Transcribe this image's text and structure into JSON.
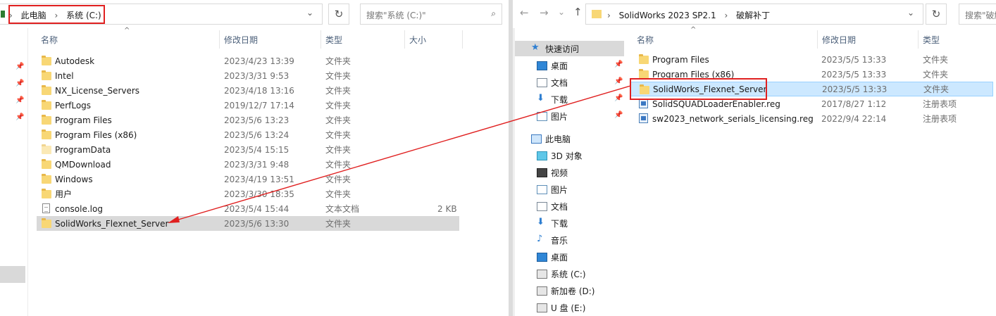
{
  "left": {
    "breadcrumb": [
      "此电脑",
      "系统 (C:)"
    ],
    "search_placeholder": "搜索\"系统 (C:)\"",
    "columns": {
      "name": "名称",
      "date": "修改日期",
      "type": "类型",
      "size": "大小"
    },
    "files": [
      {
        "name": "Autodesk",
        "date": "2023/4/23 13:39",
        "type": "文件夹",
        "size": "",
        "icon": "folder-icon"
      },
      {
        "name": "Intel",
        "date": "2023/3/31 9:53",
        "type": "文件夹",
        "size": "",
        "icon": "folder-icon"
      },
      {
        "name": "NX_License_Servers",
        "date": "2023/4/18 13:16",
        "type": "文件夹",
        "size": "",
        "icon": "folder-icon"
      },
      {
        "name": "PerfLogs",
        "date": "2019/12/7 17:14",
        "type": "文件夹",
        "size": "",
        "icon": "folder-icon"
      },
      {
        "name": "Program Files",
        "date": "2023/5/6 13:23",
        "type": "文件夹",
        "size": "",
        "icon": "folder-icon"
      },
      {
        "name": "Program Files (x86)",
        "date": "2023/5/6 13:24",
        "type": "文件夹",
        "size": "",
        "icon": "folder-icon"
      },
      {
        "name": "ProgramData",
        "date": "2023/5/4 15:15",
        "type": "文件夹",
        "size": "",
        "icon": "folder-pale-icon"
      },
      {
        "name": "QMDownload",
        "date": "2023/3/31 9:48",
        "type": "文件夹",
        "size": "",
        "icon": "folder-icon"
      },
      {
        "name": "Windows",
        "date": "2023/4/19 13:51",
        "type": "文件夹",
        "size": "",
        "icon": "folder-icon"
      },
      {
        "name": "用户",
        "date": "2023/3/30 18:35",
        "type": "文件夹",
        "size": "",
        "icon": "folder-icon"
      },
      {
        "name": "console.log",
        "date": "2023/5/4 15:44",
        "type": "文本文档",
        "size": "2 KB",
        "icon": "text-file-icon"
      },
      {
        "name": "SolidWorks_Flexnet_Server",
        "date": "2023/5/6 13:30",
        "type": "文件夹",
        "size": "",
        "icon": "folder-icon"
      }
    ]
  },
  "right": {
    "breadcrumb": [
      "SolidWorks 2023 SP2.1",
      "破解补丁"
    ],
    "search_placeholder": "搜索\"破解",
    "columns": {
      "name": "名称",
      "date": "修改日期",
      "type": "类型"
    },
    "nav": [
      {
        "label": "快速访问",
        "icon": "star-icon",
        "pinned": false
      },
      {
        "label": "桌面",
        "icon": "desktop-icon",
        "pinned": true
      },
      {
        "label": "文档",
        "icon": "documents-icon",
        "pinned": true
      },
      {
        "label": "下载",
        "icon": "download-icon",
        "pinned": true
      },
      {
        "label": "图片",
        "icon": "pictures-icon",
        "pinned": true
      },
      {
        "label": "此电脑",
        "icon": "computer-icon",
        "pinned": false
      },
      {
        "label": "3D 对象",
        "icon": "3d-objects-icon",
        "pinned": false
      },
      {
        "label": "视频",
        "icon": "video-icon",
        "pinned": false
      },
      {
        "label": "图片",
        "icon": "pictures-icon",
        "pinned": false
      },
      {
        "label": "文档",
        "icon": "documents-icon",
        "pinned": false
      },
      {
        "label": "下载",
        "icon": "download-icon",
        "pinned": false
      },
      {
        "label": "音乐",
        "icon": "music-icon",
        "pinned": false
      },
      {
        "label": "桌面",
        "icon": "desktop-icon",
        "pinned": false
      },
      {
        "label": "系统 (C:)",
        "icon": "drive-icon",
        "pinned": false
      },
      {
        "label": "新加卷 (D:)",
        "icon": "drive-icon",
        "pinned": false
      },
      {
        "label": "U 盘 (E:)",
        "icon": "usb-drive-icon",
        "pinned": false
      }
    ],
    "files": [
      {
        "name": "Program Files",
        "date": "2023/5/5 13:33",
        "type": "文件夹",
        "icon": "folder-icon"
      },
      {
        "name": "Program Files (x86)",
        "date": "2023/5/5 13:33",
        "type": "文件夹",
        "icon": "folder-icon"
      },
      {
        "name": "SolidWorks_Flexnet_Server",
        "date": "2023/5/5 13:33",
        "type": "文件夹",
        "icon": "folder-icon"
      },
      {
        "name": "SolidSQUADLoaderEnabler.reg",
        "date": "2017/8/27 1:12",
        "type": "注册表项",
        "icon": "registry-file-icon"
      },
      {
        "name": "sw2023_network_serials_licensing.reg",
        "date": "2022/9/4 22:14",
        "type": "注册表项",
        "icon": "registry-file-icon"
      }
    ]
  },
  "colors": {
    "annotation_red": "#e02020",
    "selection_gray": "#d9d9d9",
    "highlight_blue": "#cce8ff"
  }
}
